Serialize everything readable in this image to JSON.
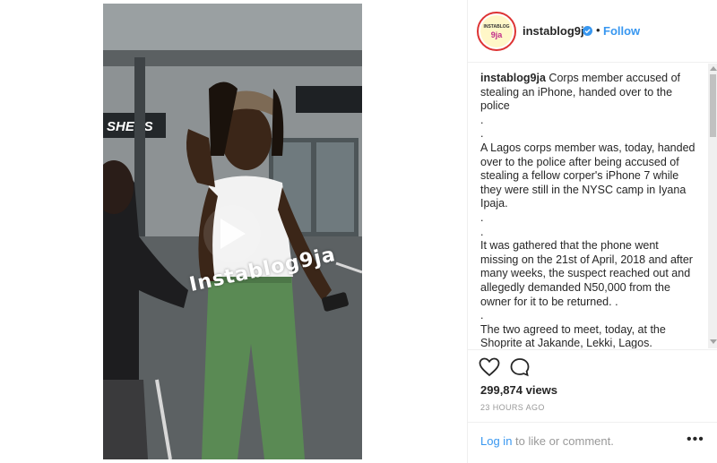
{
  "media": {
    "watermark": "Instablog9ja",
    "signage": "SHERS"
  },
  "header": {
    "avatar_line1": "INSTABLOG",
    "avatar_line2": "9ja",
    "username": "instablog9ja",
    "separator": "•",
    "follow_label": "Follow"
  },
  "caption": {
    "username": "instablog9ja",
    "title": "Corps member accused of stealing an iPhone, handed over to the police",
    "dot1": ".",
    "dot2": ".",
    "para1": "A Lagos corps member was, today, handed over to the police after being accused of stealing a fellow corper's iPhone 7 while they were still in the NYSC camp in Iyana Ipaja.",
    "dot3": ".",
    "dot4": ".",
    "para2": "It was gathered that the phone went missing on the 21st of April, 2018 and after many weeks, the suspect reached out and allegedly demanded N50,000 from the owner for it to be returned. .",
    "dot5": ".",
    "para3": "The two agreed to meet, today, at the Shoprite at Jakande, Lekki, Lagos. However, during the meeting, the suspect was"
  },
  "stats": {
    "views": "299,874 views",
    "time_ago": "23 HOURS AGO"
  },
  "login": {
    "link_label": "Log in",
    "rest": " to like or comment.",
    "more_label": "•••"
  },
  "icons": {
    "like": "heart-icon",
    "comment": "comment-icon",
    "verified": "verified-badge-icon",
    "play": "play-icon"
  },
  "colors": {
    "accent": "#3897f0",
    "verified": "#3897f0",
    "muted": "#999999",
    "text": "#262626"
  }
}
